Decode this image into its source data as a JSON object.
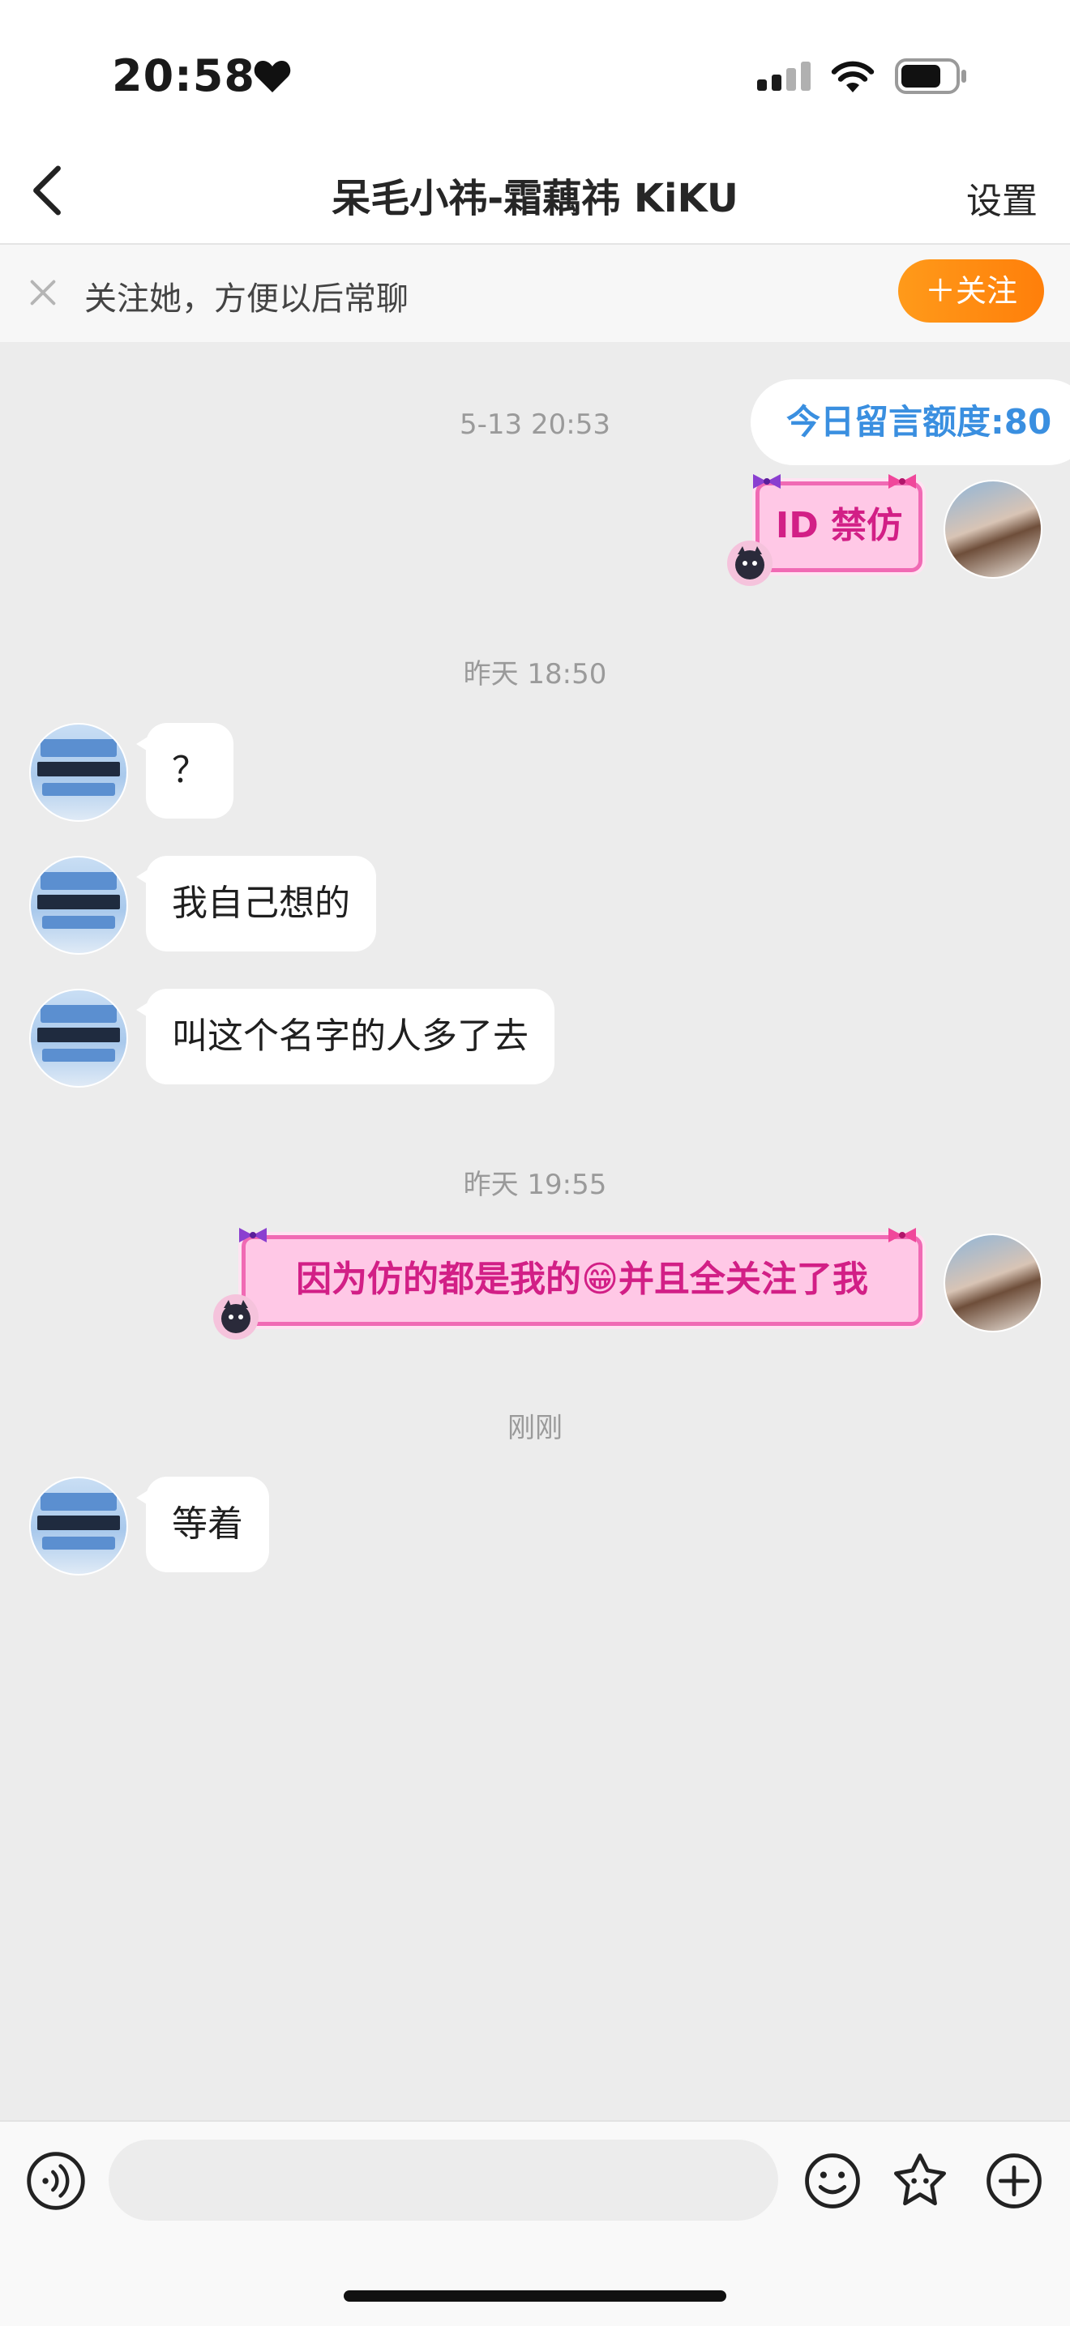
{
  "status_bar": {
    "time": "20:58"
  },
  "header": {
    "title": "呆毛小祎-霜藕祎 KiKU",
    "settings_label": "设置"
  },
  "follow_bar": {
    "text": "关注她，方便以后常聊",
    "button_label": "＋关注"
  },
  "quota": {
    "label": "今日留言额度:80"
  },
  "messages": [
    {
      "timestamp": "5-13 20:53",
      "side": "right",
      "text": "ID 禁仿"
    },
    {
      "timestamp": "昨天 18:50",
      "side": "left",
      "text": "？"
    },
    {
      "side": "left",
      "text": "我自己想的"
    },
    {
      "side": "left",
      "text": "叫这个名字的人多了去"
    },
    {
      "timestamp": "昨天 19:55",
      "side": "right",
      "text_before": "因为仿的都是我的",
      "emoji": "😁",
      "text_after": "并且全关注了我"
    },
    {
      "timestamp": "刚刚",
      "side": "left",
      "text": "等着"
    }
  ],
  "icons": {
    "back": "chevron-left-icon",
    "close": "close-icon",
    "voice": "voice-icon",
    "emoji": "smile-icon",
    "sticker": "star-face-icon",
    "add": "plus-circle-icon"
  },
  "colors": {
    "accent_orange": "#ff8a10",
    "pink_bubble": "#ffc8e6",
    "pink_text": "#d21f86",
    "quota_blue": "#3a8fe0"
  }
}
